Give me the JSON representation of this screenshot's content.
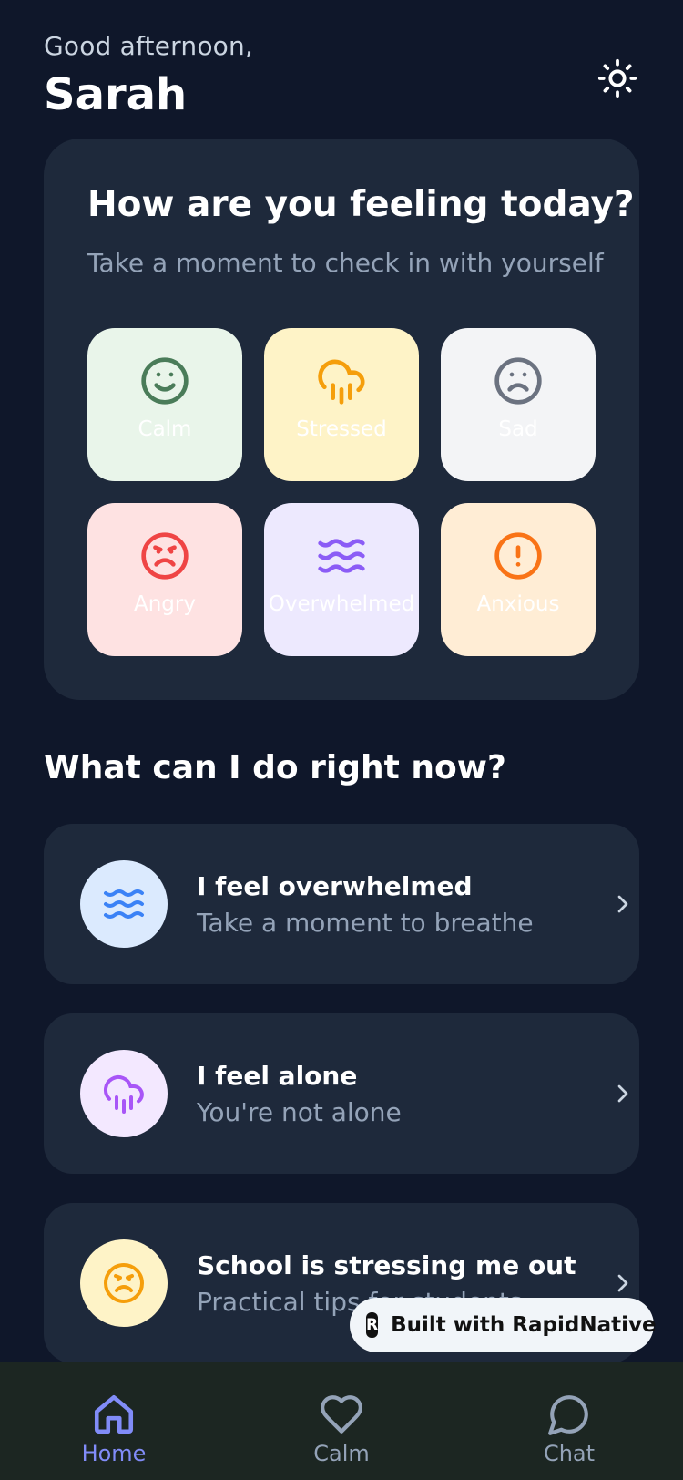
{
  "header": {
    "greeting": "Good afternoon,",
    "name": "Sarah",
    "theme_icon": "sun-icon"
  },
  "checkin": {
    "title": "How are you feeling today?",
    "subtitle": "Take a moment to check in with yourself",
    "moods": [
      {
        "label": "Calm",
        "icon": "smile-icon",
        "bg": "#e9f5ea",
        "color": "#4a7c59"
      },
      {
        "label": "Stressed",
        "icon": "cloud-rain-icon",
        "bg": "#fef3c7",
        "color": "#f59e0b"
      },
      {
        "label": "Sad",
        "icon": "frown-icon",
        "bg": "#f3f4f6",
        "color": "#6b7280"
      },
      {
        "label": "Angry",
        "icon": "angry-icon",
        "bg": "#fee2e2",
        "color": "#ef4444"
      },
      {
        "label": "Overwhelmed",
        "icon": "waves-icon",
        "bg": "#ede9fe",
        "color": "#8b5cf6"
      },
      {
        "label": "Anxious",
        "icon": "alert-circle-icon",
        "bg": "#ffedd5",
        "color": "#f97316"
      }
    ]
  },
  "actions": {
    "title": "What can I do right now?",
    "items": [
      {
        "title": "I feel overwhelmed",
        "desc": "Take a moment to breathe",
        "icon": "waves-icon",
        "bg": "#dbeafe",
        "color": "#3b82f6"
      },
      {
        "title": "I feel alone",
        "desc": "You're not alone",
        "icon": "cloud-rain-icon",
        "bg": "#f3e8ff",
        "color": "#a855f7"
      },
      {
        "title": "School is stressing me out",
        "desc": "Practical tips for students",
        "icon": "frown-icon",
        "bg": "#fef3c7",
        "color": "#f59e0b"
      }
    ]
  },
  "badge": {
    "text": "Built with RapidNative",
    "logo_letter": "R"
  },
  "tabs": [
    {
      "label": "Home",
      "icon": "home-icon",
      "active": true,
      "color": "#818cf8"
    },
    {
      "label": "Calm",
      "icon": "heart-icon",
      "active": false,
      "color": "#94a3b8"
    },
    {
      "label": "Chat",
      "icon": "message-circle-icon",
      "active": false,
      "color": "#94a3b8"
    }
  ],
  "colors": {
    "background": "#0f172a",
    "card": "#1e293b",
    "muted_text": "#94a3b8",
    "tabbar": "#1c2622"
  }
}
